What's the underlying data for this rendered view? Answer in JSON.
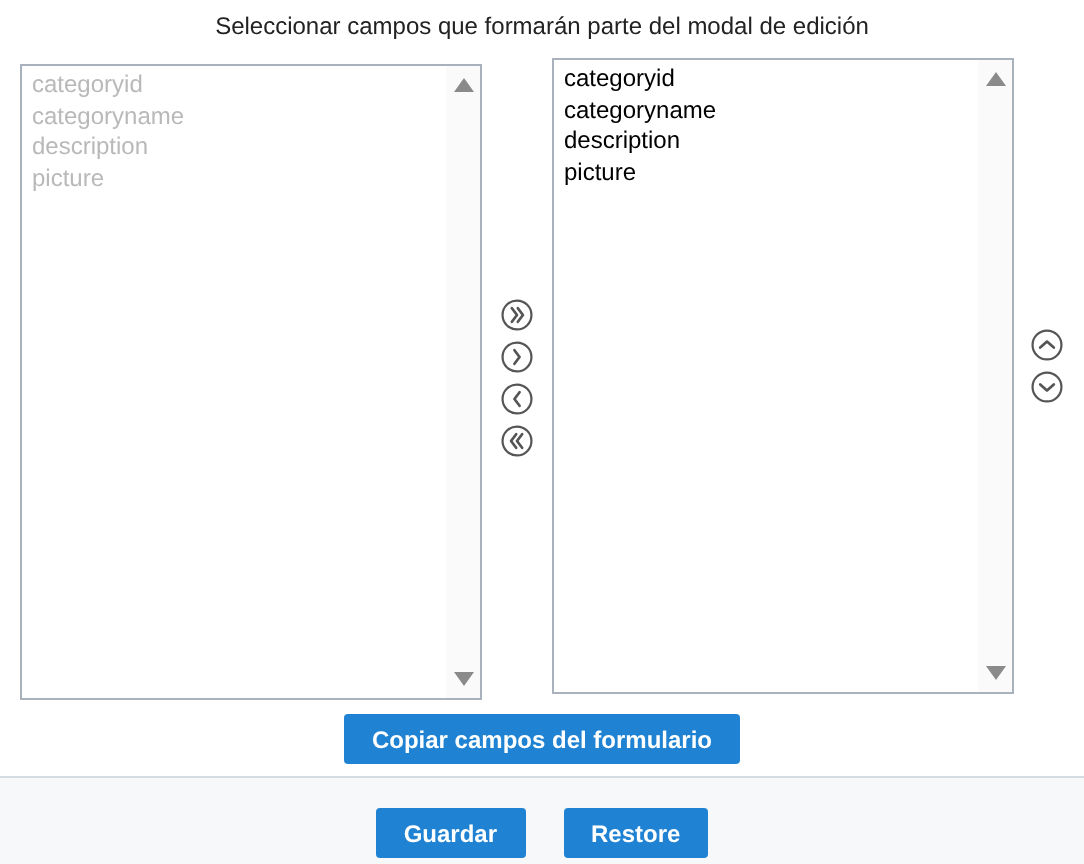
{
  "title": "Seleccionar campos que formarán parte del modal de edición",
  "available_list": {
    "items": [
      {
        "label": "categoryid",
        "disabled": true
      },
      {
        "label": "categoryname",
        "disabled": true
      },
      {
        "label": "description",
        "disabled": true
      },
      {
        "label": "picture",
        "disabled": true
      }
    ]
  },
  "transfer_buttons": [
    {
      "kind": "all-right"
    },
    {
      "kind": "right"
    },
    {
      "kind": "left"
    },
    {
      "kind": "all-left"
    }
  ],
  "selected_list": {
    "items": [
      {
        "label": "categoryid",
        "disabled": false
      },
      {
        "label": "categoryname",
        "disabled": false
      },
      {
        "label": "description",
        "disabled": false
      },
      {
        "label": "picture",
        "disabled": false
      }
    ]
  },
  "order_buttons": [
    {
      "kind": "up"
    },
    {
      "kind": "down"
    }
  ],
  "copy_button": "Copiar campos del formulario",
  "footer_buttons": [
    "Guardar",
    "Restore"
  ]
}
